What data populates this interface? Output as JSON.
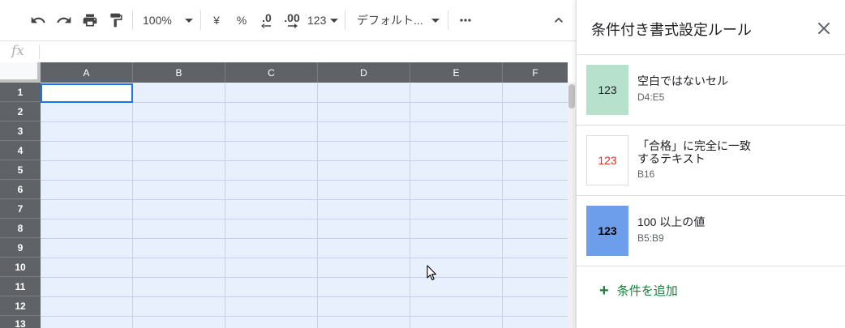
{
  "toolbar": {
    "zoom": "100%",
    "currency": "¥",
    "percent": "%",
    "decrease_decimal": ".0",
    "increase_decimal": ".00",
    "number_format": "123",
    "font": "デフォルト..."
  },
  "formula_bar": {
    "fx_label": "fx"
  },
  "grid": {
    "columns": [
      "A",
      "B",
      "C",
      "D",
      "E",
      "F"
    ],
    "rows": [
      "1",
      "2",
      "3",
      "4",
      "5",
      "6",
      "7",
      "8",
      "9",
      "10",
      "11",
      "12",
      "13"
    ]
  },
  "panel": {
    "title": "条件付き書式設定ルール",
    "rules": [
      {
        "preview": "123",
        "line1": "空白ではないセル",
        "line2": "",
        "range": "D4:E5",
        "swatch_bg": "#b7e1cd",
        "swatch_color": "#202124"
      },
      {
        "preview": "123",
        "line1": "「合格」に完全に一致",
        "line2": "するテキスト",
        "range": "B16",
        "swatch_bg": "#ffffff",
        "swatch_color": "#d93025"
      },
      {
        "preview": "123",
        "line1": "100 以上の値",
        "line2": "",
        "range": "B5:B9",
        "swatch_bg": "#6d9eeb",
        "swatch_color": "#000000"
      }
    ],
    "add_rule": "条件を追加"
  },
  "colors": {
    "accent_green": "#188038",
    "selection_blue": "#1a73e8",
    "header_gray": "#5f6368",
    "range_fill": "#e8f0fe"
  }
}
